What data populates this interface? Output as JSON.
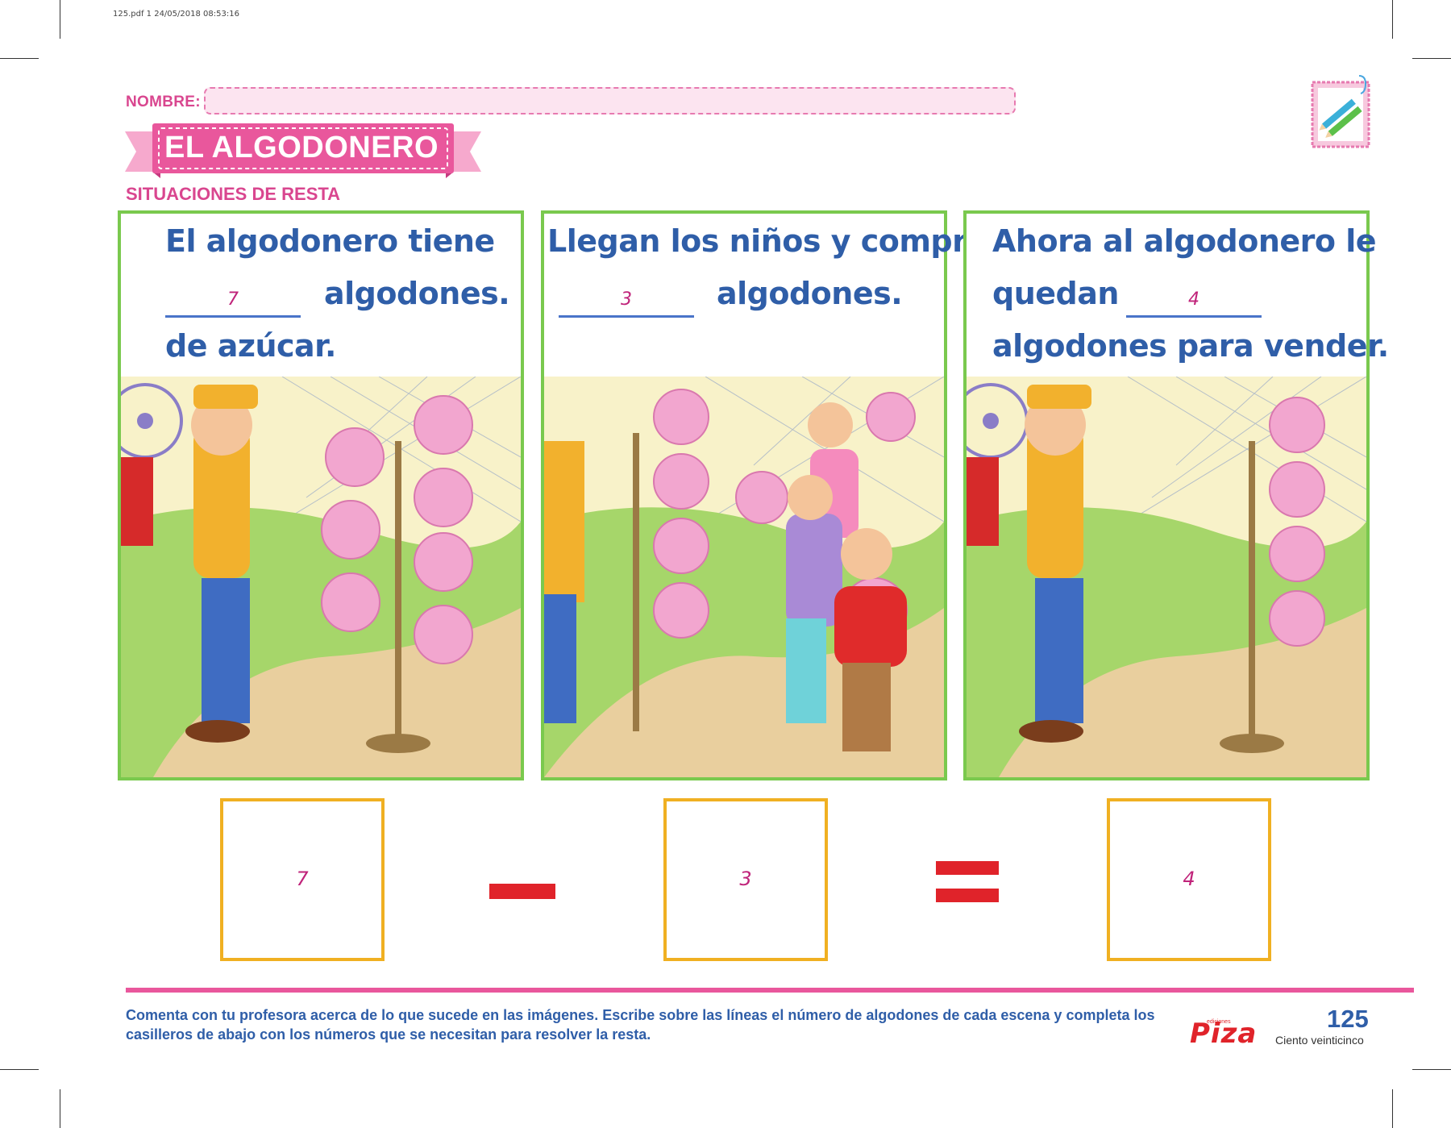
{
  "print_meta": "125.pdf   1   24/05/2018   08:53:16",
  "header": {
    "nombre_label": "NOMBRE:",
    "title": "EL ALGODONERO",
    "subtitle": "SITUACIONES DE RESTA"
  },
  "panels": [
    {
      "line1": "El algodonero tiene",
      "blank_value": "7",
      "line2_after": "algodones.",
      "line3": "de azúcar."
    },
    {
      "line1": "Llegan los niños y compran",
      "blank_value": "3",
      "line2_after": "algodones."
    },
    {
      "line1": "Ahora al algodonero le",
      "line2_before": "quedan",
      "blank_value": "4",
      "line3": "algodones para vender."
    }
  ],
  "equation": {
    "minuend": "7",
    "subtrahend": "3",
    "result": "4"
  },
  "footer": {
    "instructions": "Comenta con tu profesora acerca de lo que sucede en las imágenes. Escribe sobre las líneas el número de algodones de cada escena y completa los casilleros de abajo con los números que se necesitan para resolver la resta.",
    "brand_small": "ediciones",
    "brand": "Piza",
    "page_number": "125",
    "page_words": "Ciento veinticinco"
  },
  "colors": {
    "pink": "#d9468f",
    "blue_text": "#2f5ea8",
    "green_border": "#7ac94e",
    "orange_box": "#f0b022",
    "red_sign": "#e0232a"
  }
}
